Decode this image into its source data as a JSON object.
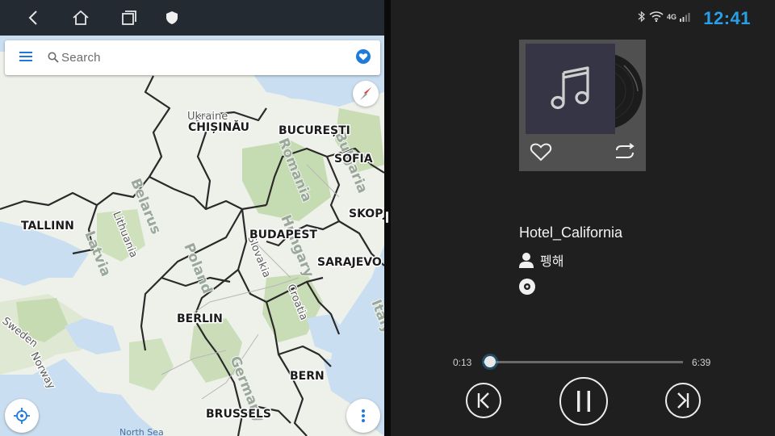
{
  "map_app": {
    "search": {
      "placeholder": "Search"
    },
    "labels": {
      "ukraine": "Ukraine",
      "chisinau": "CHIȘINĂU",
      "bucuresti": "BUCUREȘTI",
      "sofia": "SOFIA",
      "skopje": "SKOPJ",
      "tallinn": "TALLINN",
      "budapest": "BUDAPEST",
      "sarajevo": "SARAJEVO",
      "berlin": "BERLIN",
      "bern": "BERN",
      "brussels": "BRUSSELS",
      "belarus": "Belarus",
      "romania": "Romania",
      "bulgaria": "Bulgaria",
      "latvia": "Latvia",
      "lithuania": "Lithuania",
      "poland": "Poland",
      "hungary": "Hungary",
      "slovakia": "Slovakia",
      "croatia": "Croatia",
      "germany": "Germany",
      "italy": "Italy",
      "sweden": "Sweden",
      "norway": "Norway",
      "north_sea": "North Sea"
    },
    "colors": {
      "water": "#c9def0",
      "land": "#eef0ea",
      "forest": "#c9dcb6",
      "border": "#2a2a2a",
      "accent": "#1e7bdc"
    }
  },
  "status_bar": {
    "time": "12:41",
    "network": "4G"
  },
  "player": {
    "song_title": "Hotel_California",
    "artist": "펭해",
    "elapsed": "0:13",
    "total": "6:39",
    "progress_fraction": 0.033,
    "accent": "#2aa0e6"
  }
}
